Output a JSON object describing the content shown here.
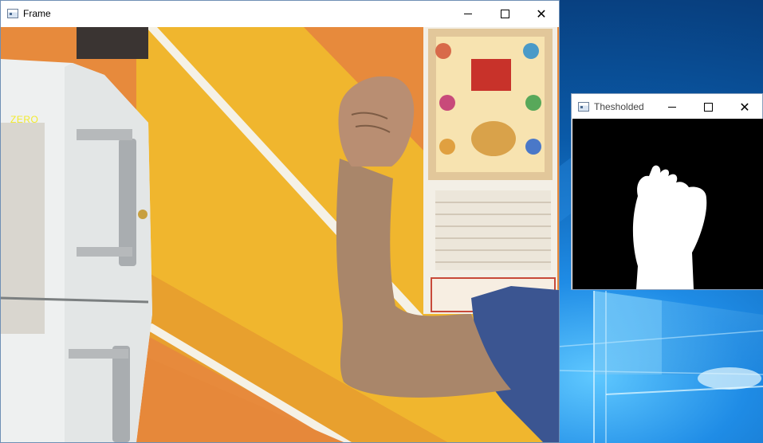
{
  "desktop": {
    "background_color": "#0b5fae"
  },
  "frame_window": {
    "title": "Frame",
    "icon": "app-window-icon",
    "controls": {
      "minimize_icon": "minimize-icon",
      "maximize_icon": "maximize-icon",
      "close_icon": "close-icon",
      "close_glyph": "✕"
    },
    "overlay_label": "ZERO",
    "overlay_label_color": "#f2ea2a"
  },
  "threshold_window": {
    "title": "Thesholded",
    "icon": "app-window-icon",
    "controls": {
      "minimize_icon": "minimize-icon",
      "maximize_icon": "maximize-icon",
      "close_icon": "close-icon",
      "close_glyph": "✕"
    }
  }
}
